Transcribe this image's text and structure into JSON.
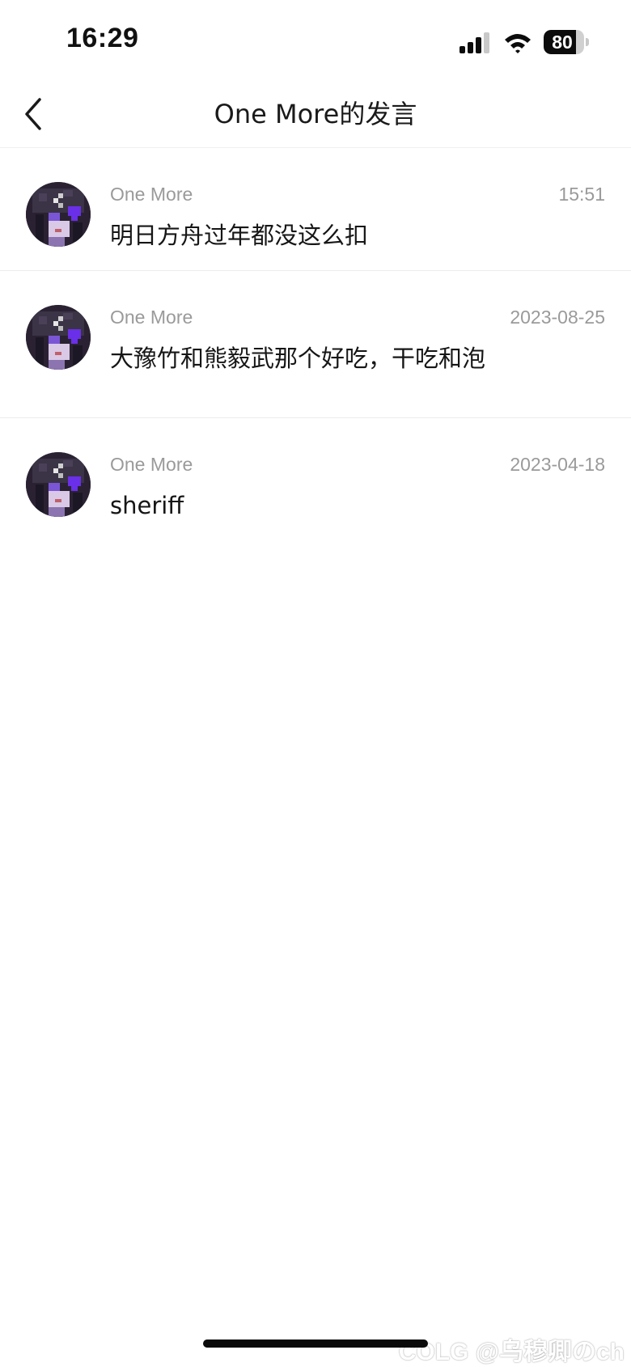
{
  "status_bar": {
    "time": "16:29",
    "battery_level": "80",
    "battery_fraction": 0.8,
    "icons": [
      "signal-icon",
      "wifi-icon",
      "battery-icon"
    ]
  },
  "nav": {
    "back_icon": "chevron-left-icon",
    "title": "One More的发言"
  },
  "posts": [
    {
      "author": "One More",
      "time": "15:51",
      "content": "明日方舟过年都没这么扣",
      "avatar_icon": "pixel-avatar"
    },
    {
      "author": "One More",
      "time": "2023-08-25",
      "content": "大豫竹和熊毅武那个好吃，干吃和泡",
      "avatar_icon": "pixel-avatar"
    },
    {
      "author": "One More",
      "time": "2023-04-18",
      "content": "sheriff",
      "avatar_icon": "pixel-avatar"
    }
  ],
  "watermark": "COLG @乌穆卿のch",
  "colors": {
    "background": "#ffffff",
    "meta_text": "#9a9a9a",
    "body_text": "#161616",
    "divider": "#ececec"
  }
}
